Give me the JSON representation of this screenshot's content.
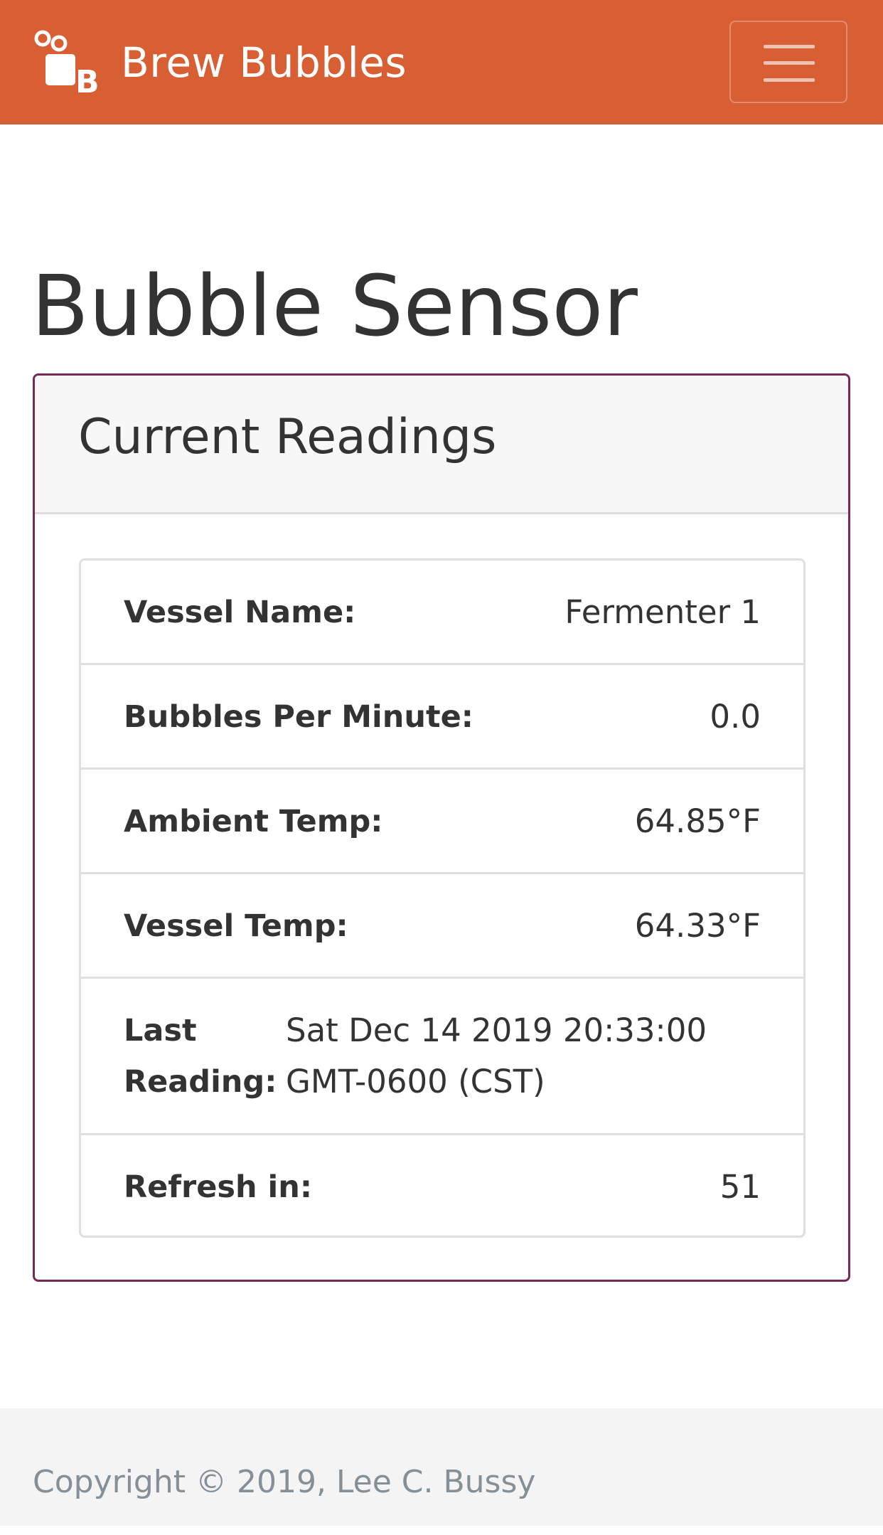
{
  "navbar": {
    "brand": "Brew Bubbles",
    "logo_icon": "bubbles-b-logo-icon",
    "toggle_icon": "hamburger-menu-icon",
    "color": "#d85f33"
  },
  "page": {
    "title": "Bubble Sensor"
  },
  "card": {
    "title": "Current Readings",
    "border_color": "#772953",
    "rows": [
      {
        "label": "Vessel Name:",
        "value": "Fermenter 1"
      },
      {
        "label": "Bubbles Per Minute:",
        "value": "0.0"
      },
      {
        "label": "Ambient Temp:",
        "value": "64.85°F"
      },
      {
        "label": "Vessel Temp:",
        "value": "64.33°F"
      },
      {
        "label": "Last Reading:",
        "value": "Sat Dec 14 2019 20:33:00 GMT-0600 (CST)"
      },
      {
        "label": "Refresh in:",
        "value": "51"
      }
    ]
  },
  "footer": {
    "copyright": "Copyright © 2019, Lee C. Bussy"
  }
}
